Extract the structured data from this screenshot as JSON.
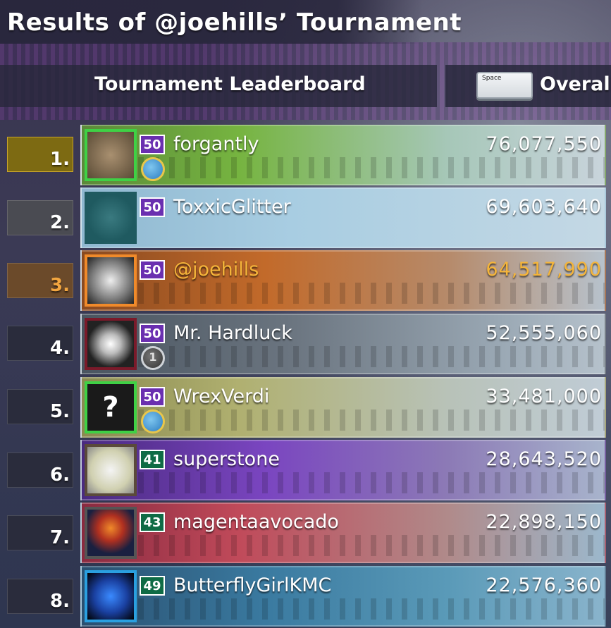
{
  "header": {
    "title": "Results of @joehills’ Tournament",
    "leaderboard_title": "Tournament Leaderboard",
    "key_hint": "Space",
    "toggle_label": "Overall"
  },
  "colors": {
    "gold": "#c9a52a",
    "bronze_text": "#f2a640",
    "level_purple": "#6a2fb0",
    "level_green": "#0f6b45"
  },
  "entries": [
    {
      "rank": "1.",
      "name": "forgantly",
      "level": "50",
      "score": "76,077,550",
      "avatar_icon": "echidna-icon",
      "badge_icon": "shark-badge-icon"
    },
    {
      "rank": "2.",
      "name": "ToxxicGlitter",
      "level": "50",
      "score": "69,603,640",
      "avatar_icon": "chest-monster-icon"
    },
    {
      "rank": "3.",
      "name": "@joehills",
      "level": "50",
      "score": "64,517,990",
      "avatar_icon": "skeleton-dice-icon"
    },
    {
      "rank": "4.",
      "name": "Mr. Hardluck",
      "level": "50",
      "score": "52,555,060",
      "avatar_icon": "skull-tophat-icon",
      "badge_icon": "silver-1-badge-icon"
    },
    {
      "rank": "5.",
      "name": "WrexVerdi",
      "level": "50",
      "score": "33,481,000",
      "avatar_icon": "question-mark-icon",
      "avatar_text": "?",
      "badge_icon": "shark-badge-icon"
    },
    {
      "rank": "6.",
      "name": "superstone",
      "level": "41",
      "score": "28,643,520",
      "avatar_icon": "cartoon-characters-icon"
    },
    {
      "rank": "7.",
      "name": "magentaavocado",
      "level": "43",
      "score": "22,898,150",
      "avatar_icon": "orange-orb-figure-icon"
    },
    {
      "rank": "8.",
      "name": "ButterflyGirlKMC",
      "level": "49",
      "score": "22,576,360",
      "avatar_icon": "blue-butterfly-icon"
    }
  ]
}
